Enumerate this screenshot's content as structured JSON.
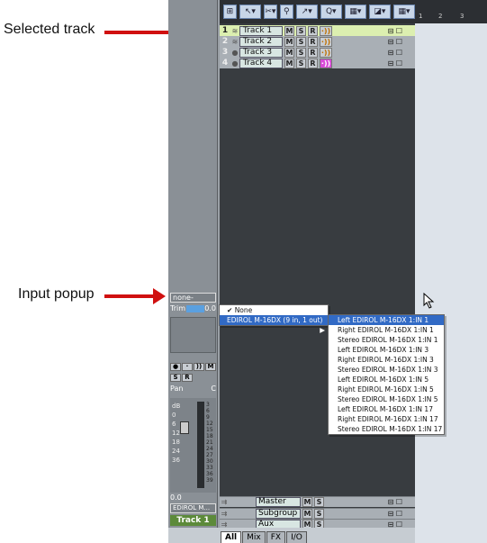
{
  "annotations": {
    "selected_track": "Selected track",
    "input_popup": "Input popup"
  },
  "toolbar": {
    "buttons": [
      "⊞",
      "↖▾",
      "✂▾",
      "⚲",
      "↗▾",
      "Q▾",
      "▦▾",
      "◪▾",
      "▦▾"
    ]
  },
  "ruler": {
    "marks": [
      "1",
      "2",
      "3"
    ]
  },
  "tracks": [
    {
      "num": "1",
      "name": "Track 1",
      "m": "M",
      "s": "S",
      "r": "R",
      "selected": true
    },
    {
      "num": "2",
      "name": "Track 2",
      "m": "M",
      "s": "S",
      "r": "R",
      "selected": false
    },
    {
      "num": "3",
      "name": "Track 3",
      "m": "M",
      "s": "S",
      "r": "R",
      "selected": false
    },
    {
      "num": "4",
      "name": "Track 4",
      "m": "M",
      "s": "S",
      "r": "R",
      "selected": false
    }
  ],
  "buses": [
    {
      "name": "Master",
      "m": "M",
      "s": "S"
    },
    {
      "name": "Subgroup",
      "m": "M",
      "s": "S"
    },
    {
      "name": "Aux",
      "m": "M",
      "s": "S"
    }
  ],
  "strip": {
    "input_value": "none-",
    "trim_label": "Trim",
    "trim_value": "0.0",
    "pan_label": "Pan",
    "pan_value": "C",
    "msr": [
      "M",
      "S",
      "R"
    ],
    "db_label": "dB",
    "scale": [
      "3",
      "6",
      "9",
      "12",
      "15",
      "18",
      "21",
      "24",
      "27",
      "30",
      "33",
      "36",
      "39"
    ],
    "left_scale": [
      "0",
      "6",
      "12",
      "18",
      "24",
      "36"
    ],
    "volume": "0.0",
    "output": "EDIROL M...",
    "track_name": "Track 1"
  },
  "menu": {
    "level1": [
      {
        "label": "None",
        "checked": true
      },
      {
        "label": "EDIROL M-16DX (9 in, 1 out)",
        "has_submenu": true
      }
    ],
    "level2": [
      "Left EDIROL M-16DX 1:IN 1",
      "Right EDIROL M-16DX 1:IN 1",
      "Stereo EDIROL M-16DX 1:IN 1",
      "Left EDIROL M-16DX 1:IN 3",
      "Right EDIROL M-16DX 1:IN 3",
      "Stereo EDIROL M-16DX 1:IN 3",
      "Left EDIROL M-16DX 1:IN 5",
      "Right EDIROL M-16DX 1:IN 5",
      "Stereo EDIROL M-16DX 1:IN 5",
      "Left EDIROL M-16DX 1:IN 17",
      "Right EDIROL M-16DX 1:IN 17",
      "Stereo EDIROL M-16DX 1:IN 17"
    ]
  },
  "tabs": [
    "All",
    "Mix",
    "FX",
    "I/O"
  ],
  "colors": {
    "selected_track": "#dcefb0",
    "menu_highlight": "#316ac5",
    "arrow": "#d01010",
    "input_monitor_active": "#d84ad8"
  }
}
